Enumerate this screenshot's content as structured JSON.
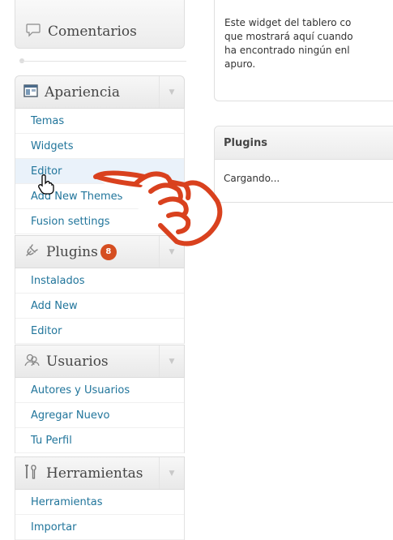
{
  "menu": {
    "comments": {
      "label": "Comentarios",
      "icon": "comment-bubble-icon"
    },
    "groups": [
      {
        "key": "appearance",
        "label": "Apariencia",
        "icon": "appearance-window-icon",
        "items": [
          "Temas",
          "Widgets",
          "Editor",
          "Add New Themes",
          "Fusion settings"
        ]
      },
      {
        "key": "plugins",
        "label": "Plugins",
        "icon": "plug-icon",
        "badge": "8",
        "items": [
          "Instalados",
          "Add New",
          "Editor"
        ]
      },
      {
        "key": "users",
        "label": "Usuarios",
        "icon": "users-icon",
        "items": [
          "Autores y Usuarios",
          "Agregar Nuevo",
          "Tu Perfil"
        ]
      },
      {
        "key": "tools",
        "label": "Herramientas",
        "icon": "tools-icon",
        "items": [
          "Herramientas",
          "Importar"
        ]
      }
    ],
    "hovered_item": "Editor"
  },
  "dashboard": {
    "widget_text": "Este widget del tablero co\nque mostrará aquí cuando\nha encontrado ningún enl\napuro.",
    "plugins_widget": {
      "title": "Plugins",
      "body": "Cargando..."
    }
  },
  "colors": {
    "link": "#21759b",
    "badge": "#d54e21",
    "annotation_hand": "#d9411e"
  }
}
